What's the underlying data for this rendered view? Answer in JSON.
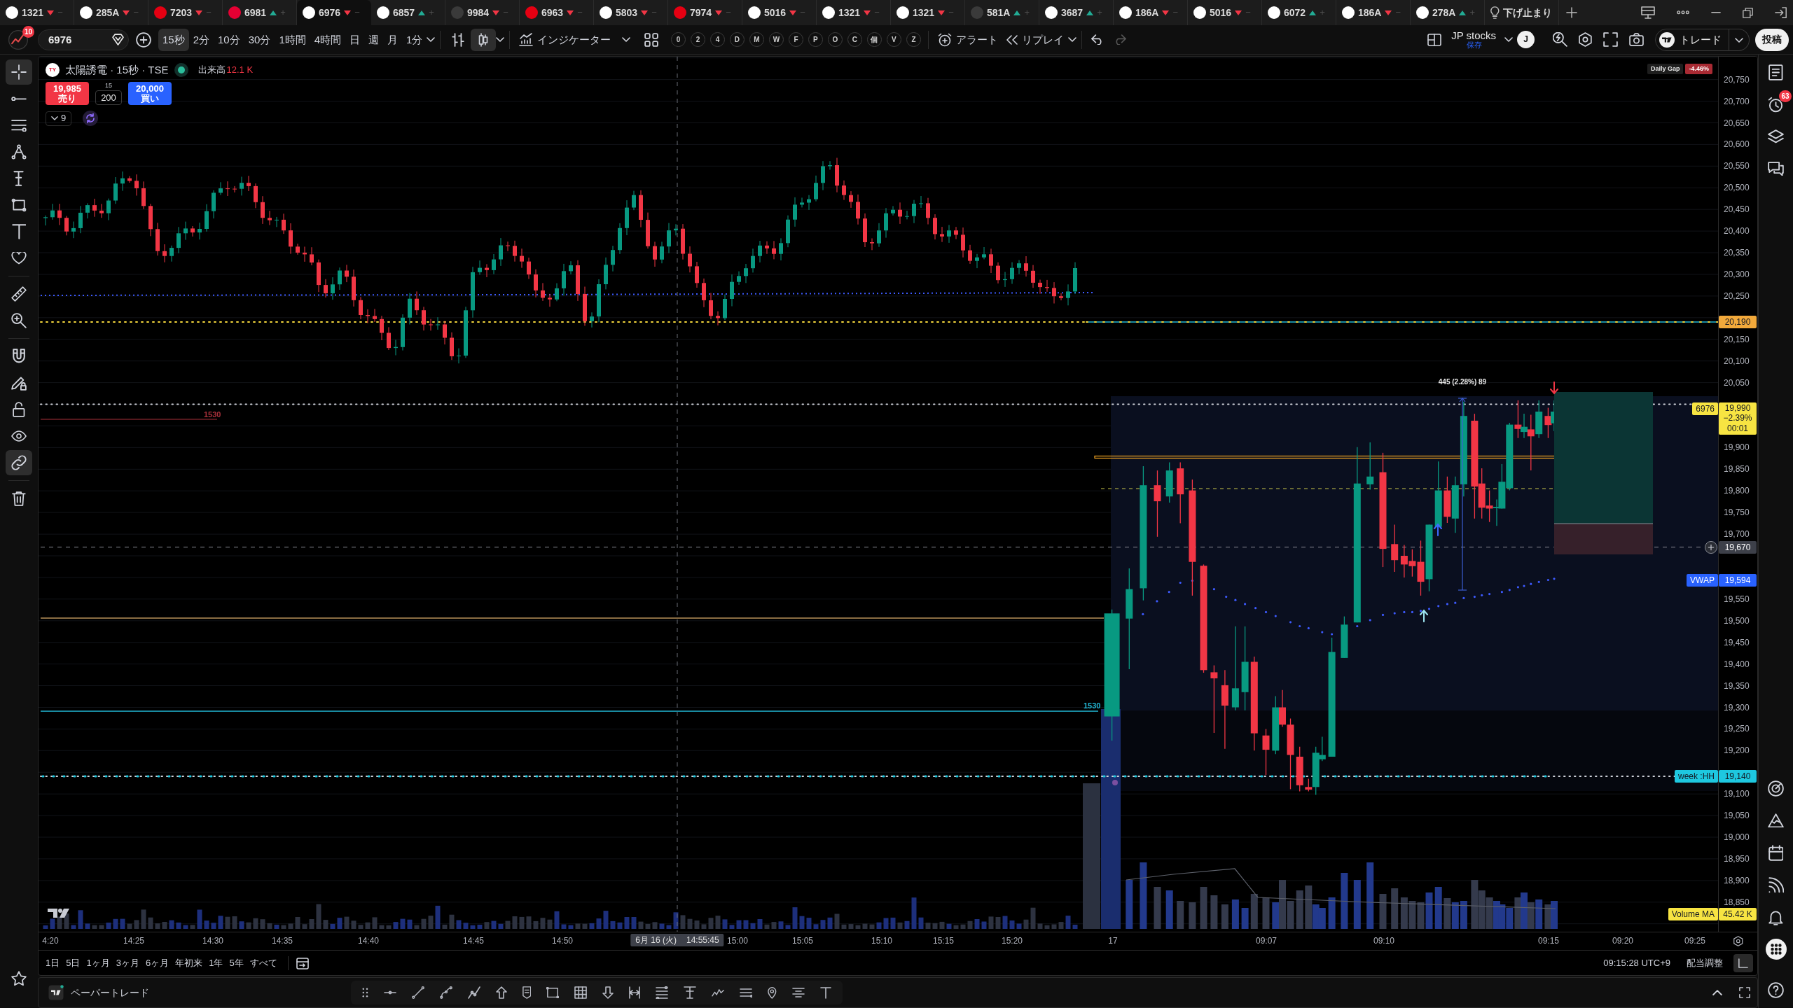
{
  "tabs": [
    {
      "kind": "symbol",
      "symbol": "1321",
      "color": "#ffffff",
      "rising": false,
      "sign": "−",
      "selected": false
    },
    {
      "kind": "symbol",
      "symbol": "285A",
      "color": "#ffffff",
      "rising": false,
      "sign": "−",
      "selected": false
    },
    {
      "kind": "symbol",
      "symbol": "7203",
      "color": "#e50012",
      "rising": false,
      "sign": "−",
      "selected": false
    },
    {
      "kind": "symbol",
      "symbol": "6981",
      "color": "#e60033",
      "rising": true,
      "sign": "+",
      "selected": false
    },
    {
      "kind": "symbol",
      "symbol": "6976",
      "color": "#ffffff",
      "rising": false,
      "sign": "−",
      "selected": true
    },
    {
      "kind": "symbol",
      "symbol": "6857",
      "color": "#ffffff",
      "rising": true,
      "sign": "+",
      "selected": false
    },
    {
      "kind": "symbol",
      "symbol": "9984",
      "color": "#3a3a3a",
      "rising": false,
      "sign": "−",
      "selected": false
    },
    {
      "kind": "symbol",
      "symbol": "6963",
      "color": "#e60012",
      "rising": false,
      "sign": "−",
      "selected": false
    },
    {
      "kind": "symbol",
      "symbol": "5803",
      "color": "#ffffff",
      "rising": false,
      "sign": "−",
      "selected": false
    },
    {
      "kind": "symbol",
      "symbol": "7974",
      "color": "#e60012",
      "rising": false,
      "sign": "−",
      "selected": false
    },
    {
      "kind": "symbol",
      "symbol": "5016",
      "color": "#ffffff",
      "rising": false,
      "sign": "−",
      "selected": false
    },
    {
      "kind": "symbol",
      "symbol": "1321",
      "color": "#ffffff",
      "rising": false,
      "sign": "−",
      "selected": false
    },
    {
      "kind": "symbol",
      "symbol": "1321",
      "color": "#ffffff",
      "rising": false,
      "sign": "−",
      "selected": false
    },
    {
      "kind": "symbol",
      "symbol": "581A",
      "color": "#3a3a3a",
      "rising": true,
      "sign": "+",
      "selected": false
    },
    {
      "kind": "symbol",
      "symbol": "3687",
      "color": "#ffffff",
      "rising": true,
      "sign": "+",
      "selected": false
    },
    {
      "kind": "symbol",
      "symbol": "186A",
      "color": "#ffffff",
      "rising": false,
      "sign": "−",
      "selected": false
    },
    {
      "kind": "symbol",
      "symbol": "5016",
      "color": "#ffffff",
      "rising": false,
      "sign": "−",
      "selected": false
    },
    {
      "kind": "symbol",
      "symbol": "6072",
      "color": "#ffffff",
      "rising": true,
      "sign": "+",
      "selected": false
    },
    {
      "kind": "symbol",
      "symbol": "186A",
      "color": "#ffffff",
      "rising": false,
      "sign": "−",
      "selected": false
    },
    {
      "kind": "symbol",
      "symbol": "278A",
      "color": "#ffffff",
      "rising": true,
      "sign": "+",
      "selected": false
    },
    {
      "kind": "note",
      "symbol": "下げ止まり",
      "selected": false
    }
  ],
  "toolbar": {
    "notification_count": "10",
    "symbol": "6976",
    "intervals": [
      {
        "label": "15秒",
        "selected": true
      },
      {
        "label": "2分",
        "selected": false
      },
      {
        "label": "10分",
        "selected": false
      },
      {
        "label": "30分",
        "selected": false
      },
      {
        "label": "1時間",
        "selected": false
      },
      {
        "label": "4時間",
        "selected": false
      },
      {
        "label": "日",
        "selected": false
      },
      {
        "label": "週",
        "selected": false
      },
      {
        "label": "月",
        "selected": false
      },
      {
        "label": "1分",
        "selected": false
      }
    ],
    "chart_styles": [
      {
        "kind": "bars",
        "selected": false
      },
      {
        "kind": "candles",
        "selected": true
      }
    ],
    "indicators": "インジケーター",
    "shortcuts": [
      "0",
      "2",
      "4",
      "D",
      "M",
      "W",
      "F",
      "P",
      "O",
      "C",
      "個",
      "V",
      "Z"
    ],
    "alert": "アラート",
    "replay": "リプレイ",
    "layout_name": "JP stocks",
    "layout_status": "保存",
    "user_initial": "J",
    "trade": "トレード",
    "publish": "投稿"
  },
  "drawing_tools": [
    {
      "kind": "crosshair",
      "active": true
    },
    {
      "kind": "trend_line",
      "active": false
    },
    {
      "kind": "fib",
      "active": false
    },
    {
      "kind": "pattern",
      "active": false
    },
    {
      "kind": "projection",
      "active": false
    },
    {
      "kind": "shape",
      "active": false
    },
    {
      "kind": "text",
      "active": false
    },
    {
      "kind": "favorites",
      "active": false
    },
    {
      "kind": "measure",
      "active": false
    },
    {
      "kind": "zoom",
      "active": false
    },
    {
      "kind": "magnet",
      "active": false
    },
    {
      "kind": "lock_drawing",
      "active": false
    },
    {
      "kind": "lock",
      "active": false
    },
    {
      "kind": "hide",
      "active": false
    },
    {
      "kind": "sync",
      "active": true
    },
    {
      "kind": "remove",
      "active": false
    }
  ],
  "legend": {
    "logo_text": "TY",
    "title": "太陽誘電 · 15秒 · TSE",
    "volume_label": "出来高",
    "volume_value": "12.1 K",
    "sell": {
      "price": "19,985",
      "label": "売り"
    },
    "step": "15",
    "quantity": "200",
    "buy": {
      "price": "20,000",
      "label": "買い"
    },
    "collapsed_count": "9"
  },
  "daily_gap": {
    "label": "Daily Gap",
    "value": "-4.46%"
  },
  "chart": {
    "measure_label": "445 (2.28%) 89",
    "level_labels": [
      {
        "text": "1530",
        "color": "#a8303a"
      },
      {
        "text": "1530",
        "color": "#22b8d6"
      }
    ]
  },
  "price_axis": {
    "labels": [
      "20,750",
      "20,700",
      "20,650",
      "20,600",
      "20,550",
      "20,500",
      "20,450",
      "20,400",
      "20,350",
      "20,300",
      "20,250",
      "20,150",
      "20,100",
      "20,050",
      "19,900",
      "19,850",
      "19,800",
      "19,750",
      "19,700",
      "19,550",
      "19,500",
      "19,450",
      "19,400",
      "19,350",
      "19,300",
      "19,250",
      "19,200",
      "19,100",
      "19,050",
      "19,000",
      "18,950",
      "18,900",
      "18,850"
    ],
    "tags": [
      {
        "kind": "price",
        "value": "20,190",
        "color": "#f2a93b"
      },
      {
        "kind": "last",
        "label": "6976",
        "value": "19,990",
        "change": "−2.39%",
        "countdown": "00:01",
        "color": "#f7e442"
      },
      {
        "kind": "crosshair",
        "value": "19,670",
        "color": "#3d4049"
      },
      {
        "kind": "indicator",
        "label": "VWAP",
        "value": "19,594",
        "color": "#2962ff"
      },
      {
        "kind": "indicator",
        "label": "week :HH",
        "value": "19,140",
        "color": "#1ec8e0"
      }
    ]
  },
  "volume_ma_tag": {
    "label": "Volume MA",
    "value": "45.42 K"
  },
  "time_axis": {
    "labels": [
      "4:20",
      "14:25",
      "14:30",
      "14:35",
      "14:40",
      "14:45",
      "14:50",
      "15:00",
      "15:05",
      "15:10",
      "15:15",
      "15:20",
      "17",
      "09:07",
      "09:10",
      "09:15",
      "09:20",
      "09:25"
    ],
    "crosshair": {
      "date": "6月 16 (火)",
      "time": "14:55:45"
    }
  },
  "range_bar": {
    "ranges": [
      "1日",
      "5日",
      "1ヶ月",
      "3ヶ月",
      "6ヶ月",
      "年初来",
      "1年",
      "5年",
      "すべて"
    ],
    "clock": "09:15:28 UTC+9",
    "adjust": "配当調整"
  },
  "right_sidebar": {
    "alerts_badge": "63"
  },
  "bottom_panel": {
    "title": "ペーパートレード"
  }
}
